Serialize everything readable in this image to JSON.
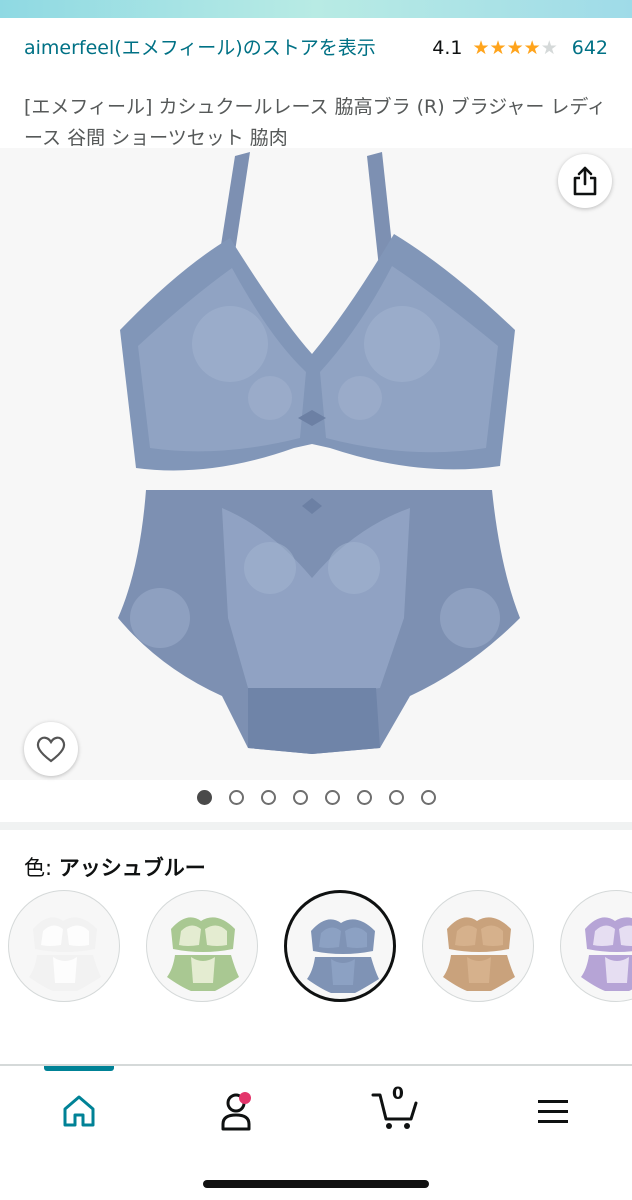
{
  "header": {
    "store_link": "aimerfeel(エメフィール)のストアを表示",
    "rating_value": "4.1",
    "rating_stars": 4.1,
    "rating_count": "642",
    "product_title": "[エメフィール] カシュクールレース 脇高ブラ (R) ブラジャー レディース 谷間 ショーツセット 脇肉"
  },
  "gallery": {
    "total_images": 8,
    "active_index": 0,
    "share_icon": "share-icon",
    "wishlist_icon": "heart-icon"
  },
  "variation": {
    "label": "色: ",
    "selected_value": "アッシュブルー",
    "swatches": [
      {
        "color": "#f2f2f2",
        "accent": "#ffffff",
        "selected": false
      },
      {
        "color": "#a9c892",
        "accent": "#eef2dc",
        "selected": false
      },
      {
        "color": "#7f93b5",
        "accent": "#8ea3c6",
        "selected": true
      },
      {
        "color": "#c9a27c",
        "accent": "#d8b48f",
        "selected": false
      },
      {
        "color": "#b6a4d6",
        "accent": "#efe9f7",
        "selected": false
      }
    ]
  },
  "bottom_nav": {
    "items": [
      {
        "name": "home",
        "icon": "home-icon",
        "active": true
      },
      {
        "name": "account",
        "icon": "account-icon",
        "badge": true
      },
      {
        "name": "cart",
        "icon": "cart-icon",
        "count": "0"
      },
      {
        "name": "menu",
        "icon": "menu-icon"
      }
    ]
  },
  "colors": {
    "link": "#007185",
    "star": "#ffa41c",
    "product_blue": "#7f93b5",
    "nav_accent": "#008296"
  }
}
